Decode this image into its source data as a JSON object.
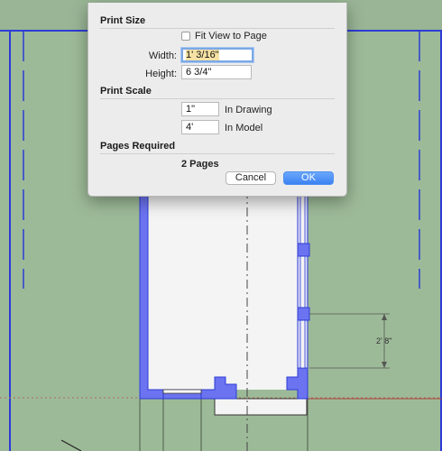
{
  "colors": {
    "background_green": "#9dba98",
    "blueprint_blue": "#2d3cd6",
    "wall_fill": "#6c73f0",
    "room_fill": "#f4f4f4",
    "accent_button": "#3c82f3"
  },
  "dialog": {
    "print_size": {
      "title": "Print Size",
      "fit_view_label": "Fit View to Page",
      "fit_view_checked": false,
      "width_label": "Width:",
      "width_value": "1' 3/16\"",
      "height_label": "Height:",
      "height_value": "6 3/4\""
    },
    "print_scale": {
      "title": "Print Scale",
      "drawing_value": "1\"",
      "drawing_label": "In Drawing",
      "model_value": "4'",
      "model_label": "In Model"
    },
    "pages_required": {
      "title": "Pages Required",
      "value": "2 Pages"
    },
    "buttons": {
      "cancel": "Cancel",
      "ok": "OK"
    }
  },
  "drawing": {
    "dimension_label": "2' 8\""
  }
}
